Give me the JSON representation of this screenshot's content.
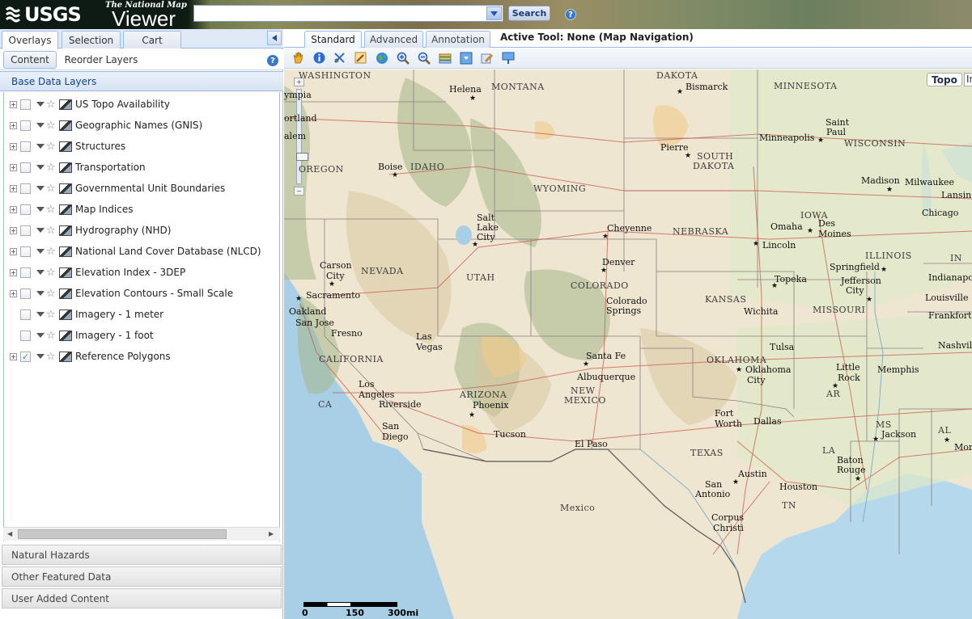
{
  "header": {
    "logo_usgs": "USGS",
    "logo_subtitle": "The National Map",
    "logo_viewer": "Viewer",
    "search_value": "",
    "search_button": "Search",
    "help": "?"
  },
  "left_tabs": [
    {
      "label": "Overlays",
      "active": true
    },
    {
      "label": "Selection",
      "active": false
    },
    {
      "label": "Cart",
      "active": false
    }
  ],
  "sub_tabs": [
    {
      "label": "Content",
      "active": true
    },
    {
      "label": "Reorder Layers",
      "active": false
    }
  ],
  "base_header": "Base Data Layers",
  "layers": [
    {
      "label": "US Topo Availability",
      "expandable": true,
      "checked": false
    },
    {
      "label": "Geographic Names (GNIS)",
      "expandable": true,
      "checked": false
    },
    {
      "label": "Structures",
      "expandable": true,
      "checked": false
    },
    {
      "label": "Transportation",
      "expandable": true,
      "checked": false
    },
    {
      "label": "Governmental Unit Boundaries",
      "expandable": true,
      "checked": false
    },
    {
      "label": "Map Indices",
      "expandable": true,
      "checked": false
    },
    {
      "label": "Hydrography (NHD)",
      "expandable": true,
      "checked": false
    },
    {
      "label": "National Land Cover Database (NLCD)",
      "expandable": true,
      "checked": false
    },
    {
      "label": "Elevation Index - 3DEP",
      "expandable": true,
      "checked": false
    },
    {
      "label": "Elevation Contours - Small Scale",
      "expandable": true,
      "checked": false
    },
    {
      "label": "Imagery - 1 meter",
      "expandable": false,
      "checked": false
    },
    {
      "label": "Imagery - 1 foot",
      "expandable": false,
      "checked": false
    },
    {
      "label": "Reference Polygons",
      "expandable": true,
      "checked": true
    }
  ],
  "accordion": [
    "Natural Hazards",
    "Other Featured Data",
    "User Added Content"
  ],
  "map_tabs": [
    {
      "label": "Standard",
      "active": true
    },
    {
      "label": "Advanced",
      "active": false
    },
    {
      "label": "Annotation",
      "active": false
    }
  ],
  "active_tool": "Active Tool: None (Map Navigation)",
  "toolbar_icons": [
    "pan-hand-icon",
    "identify-info-icon",
    "measure-icon",
    "draw-icon",
    "globe-icon",
    "zoom-in-icon",
    "zoom-out-icon",
    "layers-icon",
    "download-icon",
    "edit-icon",
    "pin-icon"
  ],
  "map": {
    "basemap_button": "Topo",
    "basemap_button2": "Im",
    "zoom_in": "+",
    "zoom_out": "−",
    "scale_labels": [
      "0",
      "150",
      "300mi"
    ],
    "states": [
      "WASHINGTON",
      "MONTANA",
      "DAKOTA",
      "MINNESOTA",
      "SOUTH",
      "DAKOTA",
      "IDAHO",
      "OREGON",
      "WYOMING",
      "WISCONSIN",
      "IOWA",
      "NEBRASKA",
      "NEVADA",
      "UTAH",
      "COLORADO",
      "KANSAS",
      "ILLINOIS",
      "IN",
      "MISSOURI",
      "CALIFORNIA",
      "OKLAHOMA",
      "ARIZONA",
      "NEW",
      "MEXICO",
      "AR",
      "TN",
      "TEXAS",
      "MS",
      "AL",
      "LA",
      "CA",
      "Mexico"
    ],
    "cities": [
      "Helena",
      "Bismarck",
      "Saint",
      "Paul",
      "Minneapolis",
      "Pierre",
      "Boise",
      "Madison",
      "Milwaukee",
      "Lansing",
      "Chicago",
      "Salt",
      "Lake",
      "City",
      "Cheyenne",
      "Omaha",
      "Des",
      "Moines",
      "Lincoln",
      "Carson",
      "City",
      "Sacramento",
      "Denver",
      "Springfield",
      "Indianapolis",
      "Jefferson",
      "City",
      "Topeka",
      "Louisville",
      "Frankfort",
      "Oakland",
      "San Jose",
      "Fresno",
      "Colorado",
      "Springs",
      "Wichita",
      "Las",
      "Vegas",
      "Santa Fe",
      "Albuquerque",
      "Tulsa",
      "Oklahoma",
      "City",
      "Little",
      "Rock",
      "Memphis",
      "Nashville",
      "Los",
      "Angeles",
      "Riverside",
      "Phoenix",
      "San",
      "Diego",
      "Tucson",
      "El Paso",
      "Fort",
      "Worth",
      "Dallas",
      "Jackson",
      "Montgomery",
      "Austin",
      "Houston",
      "Baton",
      "Rouge",
      "San",
      "Antonio",
      "Corpus",
      "Christi",
      "Olympia",
      "Portland",
      "Salem"
    ],
    "label_partials": [
      "ympia",
      "ortland",
      "alem",
      "Montg",
      "Indianapoli",
      "Louisville",
      "Frankfort",
      "Nashvill"
    ]
  }
}
